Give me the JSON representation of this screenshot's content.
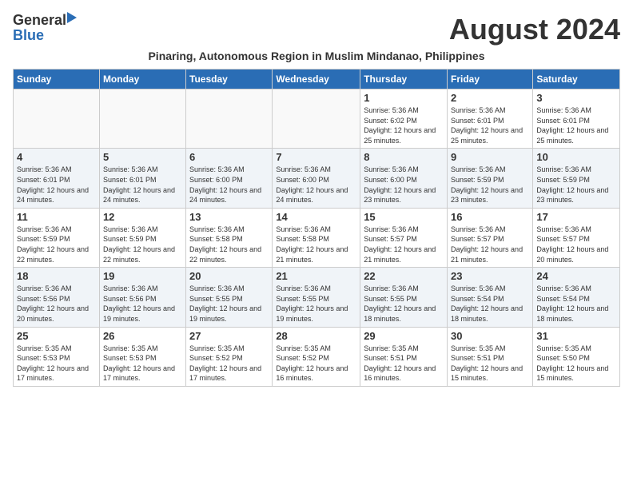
{
  "header": {
    "logo_general": "General",
    "logo_blue": "Blue",
    "month_title": "August 2024",
    "subtitle": "Pinaring, Autonomous Region in Muslim Mindanao, Philippines"
  },
  "days_of_week": [
    "Sunday",
    "Monday",
    "Tuesday",
    "Wednesday",
    "Thursday",
    "Friday",
    "Saturday"
  ],
  "weeks": [
    {
      "alt": false,
      "days": [
        {
          "num": "",
          "info": ""
        },
        {
          "num": "",
          "info": ""
        },
        {
          "num": "",
          "info": ""
        },
        {
          "num": "",
          "info": ""
        },
        {
          "num": "1",
          "info": "Sunrise: 5:36 AM\nSunset: 6:02 PM\nDaylight: 12 hours and 25 minutes."
        },
        {
          "num": "2",
          "info": "Sunrise: 5:36 AM\nSunset: 6:01 PM\nDaylight: 12 hours and 25 minutes."
        },
        {
          "num": "3",
          "info": "Sunrise: 5:36 AM\nSunset: 6:01 PM\nDaylight: 12 hours and 25 minutes."
        }
      ]
    },
    {
      "alt": true,
      "days": [
        {
          "num": "4",
          "info": "Sunrise: 5:36 AM\nSunset: 6:01 PM\nDaylight: 12 hours and 24 minutes."
        },
        {
          "num": "5",
          "info": "Sunrise: 5:36 AM\nSunset: 6:01 PM\nDaylight: 12 hours and 24 minutes."
        },
        {
          "num": "6",
          "info": "Sunrise: 5:36 AM\nSunset: 6:00 PM\nDaylight: 12 hours and 24 minutes."
        },
        {
          "num": "7",
          "info": "Sunrise: 5:36 AM\nSunset: 6:00 PM\nDaylight: 12 hours and 24 minutes."
        },
        {
          "num": "8",
          "info": "Sunrise: 5:36 AM\nSunset: 6:00 PM\nDaylight: 12 hours and 23 minutes."
        },
        {
          "num": "9",
          "info": "Sunrise: 5:36 AM\nSunset: 5:59 PM\nDaylight: 12 hours and 23 minutes."
        },
        {
          "num": "10",
          "info": "Sunrise: 5:36 AM\nSunset: 5:59 PM\nDaylight: 12 hours and 23 minutes."
        }
      ]
    },
    {
      "alt": false,
      "days": [
        {
          "num": "11",
          "info": "Sunrise: 5:36 AM\nSunset: 5:59 PM\nDaylight: 12 hours and 22 minutes."
        },
        {
          "num": "12",
          "info": "Sunrise: 5:36 AM\nSunset: 5:59 PM\nDaylight: 12 hours and 22 minutes."
        },
        {
          "num": "13",
          "info": "Sunrise: 5:36 AM\nSunset: 5:58 PM\nDaylight: 12 hours and 22 minutes."
        },
        {
          "num": "14",
          "info": "Sunrise: 5:36 AM\nSunset: 5:58 PM\nDaylight: 12 hours and 21 minutes."
        },
        {
          "num": "15",
          "info": "Sunrise: 5:36 AM\nSunset: 5:57 PM\nDaylight: 12 hours and 21 minutes."
        },
        {
          "num": "16",
          "info": "Sunrise: 5:36 AM\nSunset: 5:57 PM\nDaylight: 12 hours and 21 minutes."
        },
        {
          "num": "17",
          "info": "Sunrise: 5:36 AM\nSunset: 5:57 PM\nDaylight: 12 hours and 20 minutes."
        }
      ]
    },
    {
      "alt": true,
      "days": [
        {
          "num": "18",
          "info": "Sunrise: 5:36 AM\nSunset: 5:56 PM\nDaylight: 12 hours and 20 minutes."
        },
        {
          "num": "19",
          "info": "Sunrise: 5:36 AM\nSunset: 5:56 PM\nDaylight: 12 hours and 19 minutes."
        },
        {
          "num": "20",
          "info": "Sunrise: 5:36 AM\nSunset: 5:55 PM\nDaylight: 12 hours and 19 minutes."
        },
        {
          "num": "21",
          "info": "Sunrise: 5:36 AM\nSunset: 5:55 PM\nDaylight: 12 hours and 19 minutes."
        },
        {
          "num": "22",
          "info": "Sunrise: 5:36 AM\nSunset: 5:55 PM\nDaylight: 12 hours and 18 minutes."
        },
        {
          "num": "23",
          "info": "Sunrise: 5:36 AM\nSunset: 5:54 PM\nDaylight: 12 hours and 18 minutes."
        },
        {
          "num": "24",
          "info": "Sunrise: 5:36 AM\nSunset: 5:54 PM\nDaylight: 12 hours and 18 minutes."
        }
      ]
    },
    {
      "alt": false,
      "days": [
        {
          "num": "25",
          "info": "Sunrise: 5:35 AM\nSunset: 5:53 PM\nDaylight: 12 hours and 17 minutes."
        },
        {
          "num": "26",
          "info": "Sunrise: 5:35 AM\nSunset: 5:53 PM\nDaylight: 12 hours and 17 minutes."
        },
        {
          "num": "27",
          "info": "Sunrise: 5:35 AM\nSunset: 5:52 PM\nDaylight: 12 hours and 17 minutes."
        },
        {
          "num": "28",
          "info": "Sunrise: 5:35 AM\nSunset: 5:52 PM\nDaylight: 12 hours and 16 minutes."
        },
        {
          "num": "29",
          "info": "Sunrise: 5:35 AM\nSunset: 5:51 PM\nDaylight: 12 hours and 16 minutes."
        },
        {
          "num": "30",
          "info": "Sunrise: 5:35 AM\nSunset: 5:51 PM\nDaylight: 12 hours and 15 minutes."
        },
        {
          "num": "31",
          "info": "Sunrise: 5:35 AM\nSunset: 5:50 PM\nDaylight: 12 hours and 15 minutes."
        }
      ]
    }
  ]
}
